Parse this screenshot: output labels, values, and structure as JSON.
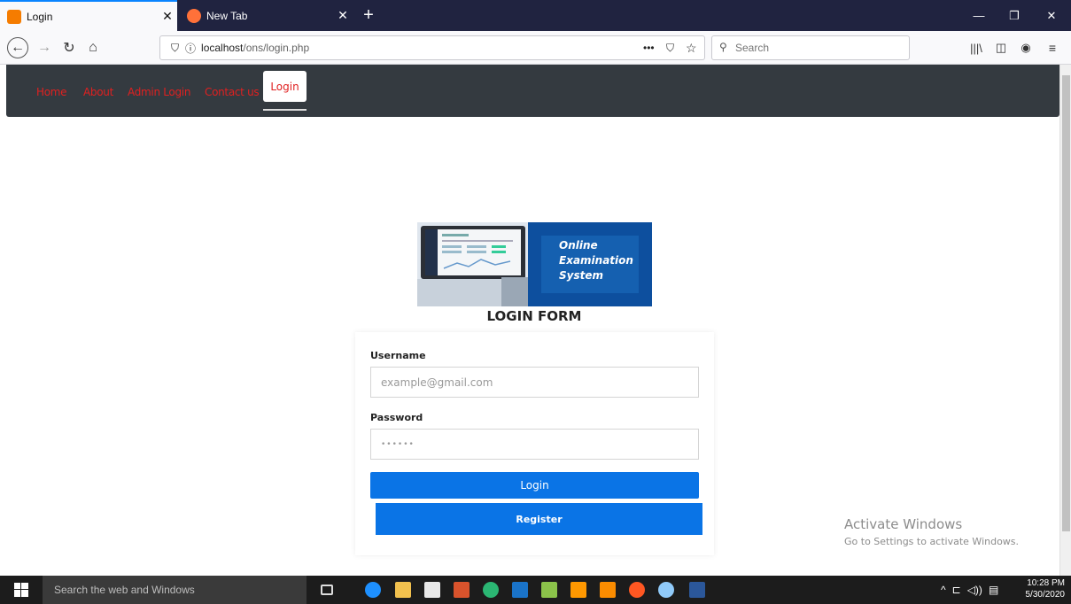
{
  "browser": {
    "tabs": [
      {
        "title": "Login",
        "active": true
      },
      {
        "title": "New Tab",
        "active": false
      }
    ],
    "url_host": "localhost",
    "url_path": "/ons/login.php",
    "search_placeholder": "Search",
    "page_actions": "•••"
  },
  "site_nav": {
    "links": [
      "Home",
      "About",
      "Admin Login",
      "Contact us"
    ],
    "active_link": "Login"
  },
  "banner": {
    "line1": "Online",
    "line2": "Examination",
    "line3": "System"
  },
  "login_form": {
    "title": "LOGIN FORM",
    "username_label": "Username",
    "username_placeholder": "example@gmail.com",
    "password_label": "Password",
    "password_placeholder": "••••••",
    "login_button": "Login",
    "register_button": "Register"
  },
  "watermark": {
    "line1": "Activate Windows",
    "line2": "Go to Settings to activate Windows."
  },
  "taskbar": {
    "search_placeholder": "Search the web and Windows",
    "time": "10:28 PM",
    "date": "5/30/2020"
  },
  "colors": {
    "nav_bg": "#343a40",
    "nav_link": "#e02020",
    "button_blue": "#0a74e6",
    "tab_strip": "#202340"
  }
}
